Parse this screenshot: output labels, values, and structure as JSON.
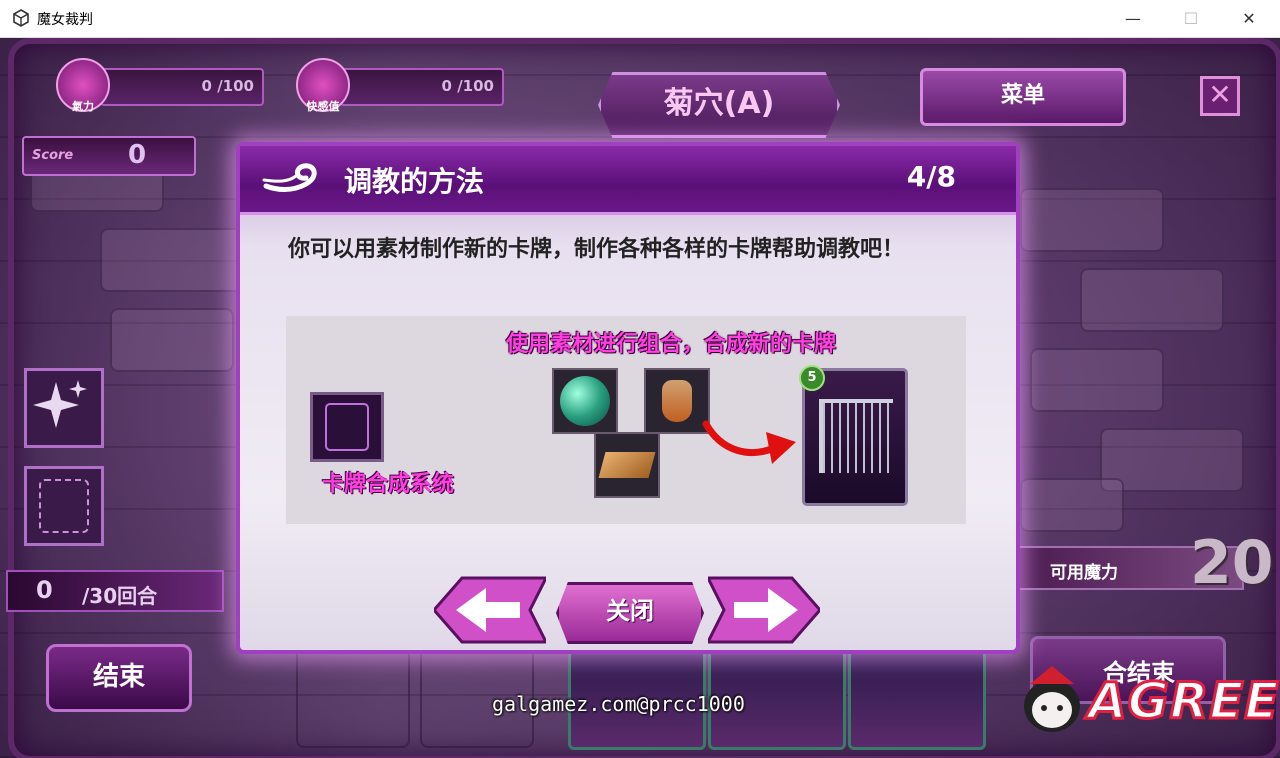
{
  "window": {
    "title": "魔女裁判",
    "min": "—",
    "max": "☐",
    "close": "✕"
  },
  "hud": {
    "gauge1": {
      "icon_label": "氣力",
      "value": "0 /100"
    },
    "gauge2": {
      "icon_label": "快感值",
      "value": "0 /100"
    },
    "stage_title": "菊穴(A)",
    "menu_label": "菜单",
    "close_glyph": "✕",
    "score_label": "Score",
    "score_value": "0",
    "turns_current": "0",
    "turns_max": "/30回合",
    "end_label": "结束",
    "mana_label": "可用魔力",
    "mana_value": "20",
    "turn_end_label": "合结束"
  },
  "dialog": {
    "title": "调教的方法",
    "page": "4/8",
    "description": "你可以用素材制作新的卡牌，制作各种各样的卡牌帮助调教吧！",
    "caption_top": "使用素材进行组合，合成新的卡牌",
    "caption_bottom": "卡牌合成系统",
    "card_cost": "5",
    "close_label": "关闭"
  },
  "watermark": "galgamez.com@prcc1000",
  "logo_text": "AGREE",
  "colors": {
    "accent": "#a040c0",
    "caption": "#ff40e0",
    "frame": "#5c2868"
  }
}
